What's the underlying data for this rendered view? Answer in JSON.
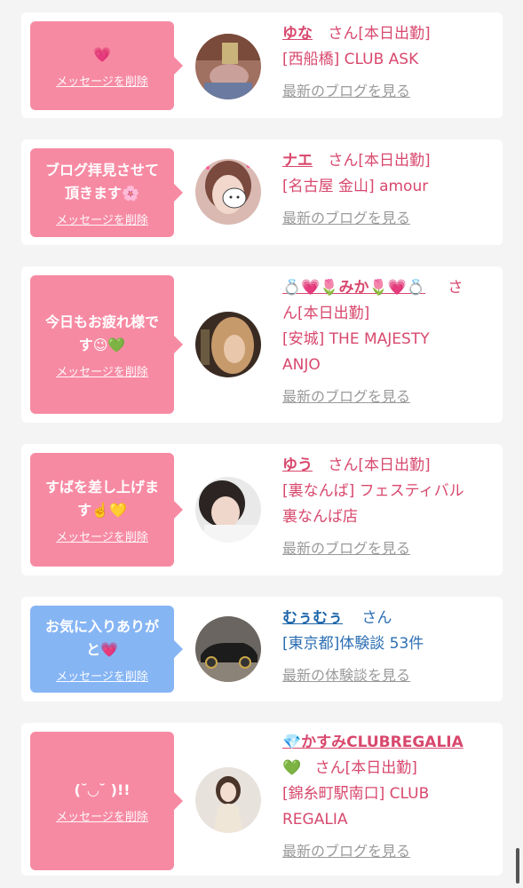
{
  "delete_label": "メッセージを削除",
  "san_label": "さん",
  "cards": [
    {
      "message": "💗",
      "name": "ゆな",
      "status": "[本日出勤]",
      "location": "[西船橋] CLUB ASK",
      "link": "最新のブログを見る"
    },
    {
      "message_line1": "ブログ拝見させて",
      "message_line2": "頂きます🌸",
      "name": "ナエ",
      "status": "[本日出勤]",
      "location": "[名古屋 金山] amour",
      "link": "最新のブログを見る"
    },
    {
      "message_line1": "今日もお疲れ様で",
      "message_line2": "す😉💚",
      "name": "💍💗🌷みか🌷💗💍",
      "name_suffix": "さ",
      "status": "ん[本日出勤]",
      "location_line1": "[安城] THE MAJESTY",
      "location_line2": "ANJO",
      "link": "最新のブログを見る"
    },
    {
      "message_line1": "すばを差し上げま",
      "message_line2": "す☝️💛",
      "name": "ゆう",
      "status": "[本日出勤]",
      "location_line1": "[裏なんば] フェスティバル",
      "location_line2": "裏なんば店",
      "link": "最新のブログを見る"
    },
    {
      "message_line1": "お気に入りありが",
      "message_line2": "と💗",
      "name": "むぅむぅ",
      "location": "[東京都]体験談 53件",
      "link": "最新の体験談を見る"
    },
    {
      "message": "(˘◡˘ )!!",
      "name": "💎かすみCLUBREGALIA",
      "name_line2": "💚",
      "status": "[本日出勤]",
      "location_line1": "[錦糸町駅南口] CLUB",
      "location_line2": "REGALIA",
      "link": "最新のブログを見る"
    }
  ]
}
